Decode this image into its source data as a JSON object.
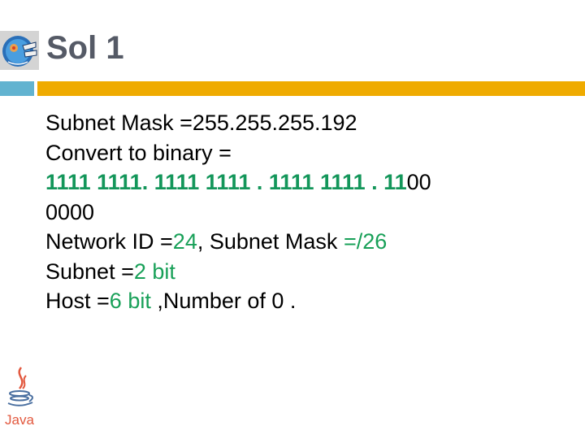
{
  "header": {
    "title": "Sol 1",
    "logo_icon": "globe-network-icon"
  },
  "colors": {
    "title": "#555a66",
    "accent_blue": "#62b3d0",
    "accent_gold": "#efab00",
    "highlight_green": "#18a058"
  },
  "content": {
    "line1": {
      "label": "Subnet Mask =",
      "value": "255.255.255.192"
    },
    "line2": {
      "label": "Convert to binary ="
    },
    "line3": {
      "green": "1111 1111. 1111 1111 . 1111 1111 . 11",
      "black": "00"
    },
    "line4": {
      "text": "0000"
    },
    "line5": {
      "label1": "Network  ID =",
      "value1": "24",
      "label2": ", Subnet Mask ",
      "value2": "=/26"
    },
    "line6": {
      "label": "Subnet =",
      "value": "2 bit"
    },
    "line7": {
      "label": "Host =",
      "value": "6 bit",
      "suffix": " ,Number of 0 ."
    }
  },
  "footer": {
    "logo_icon": "java-logo-icon",
    "logo_text": "Java"
  }
}
